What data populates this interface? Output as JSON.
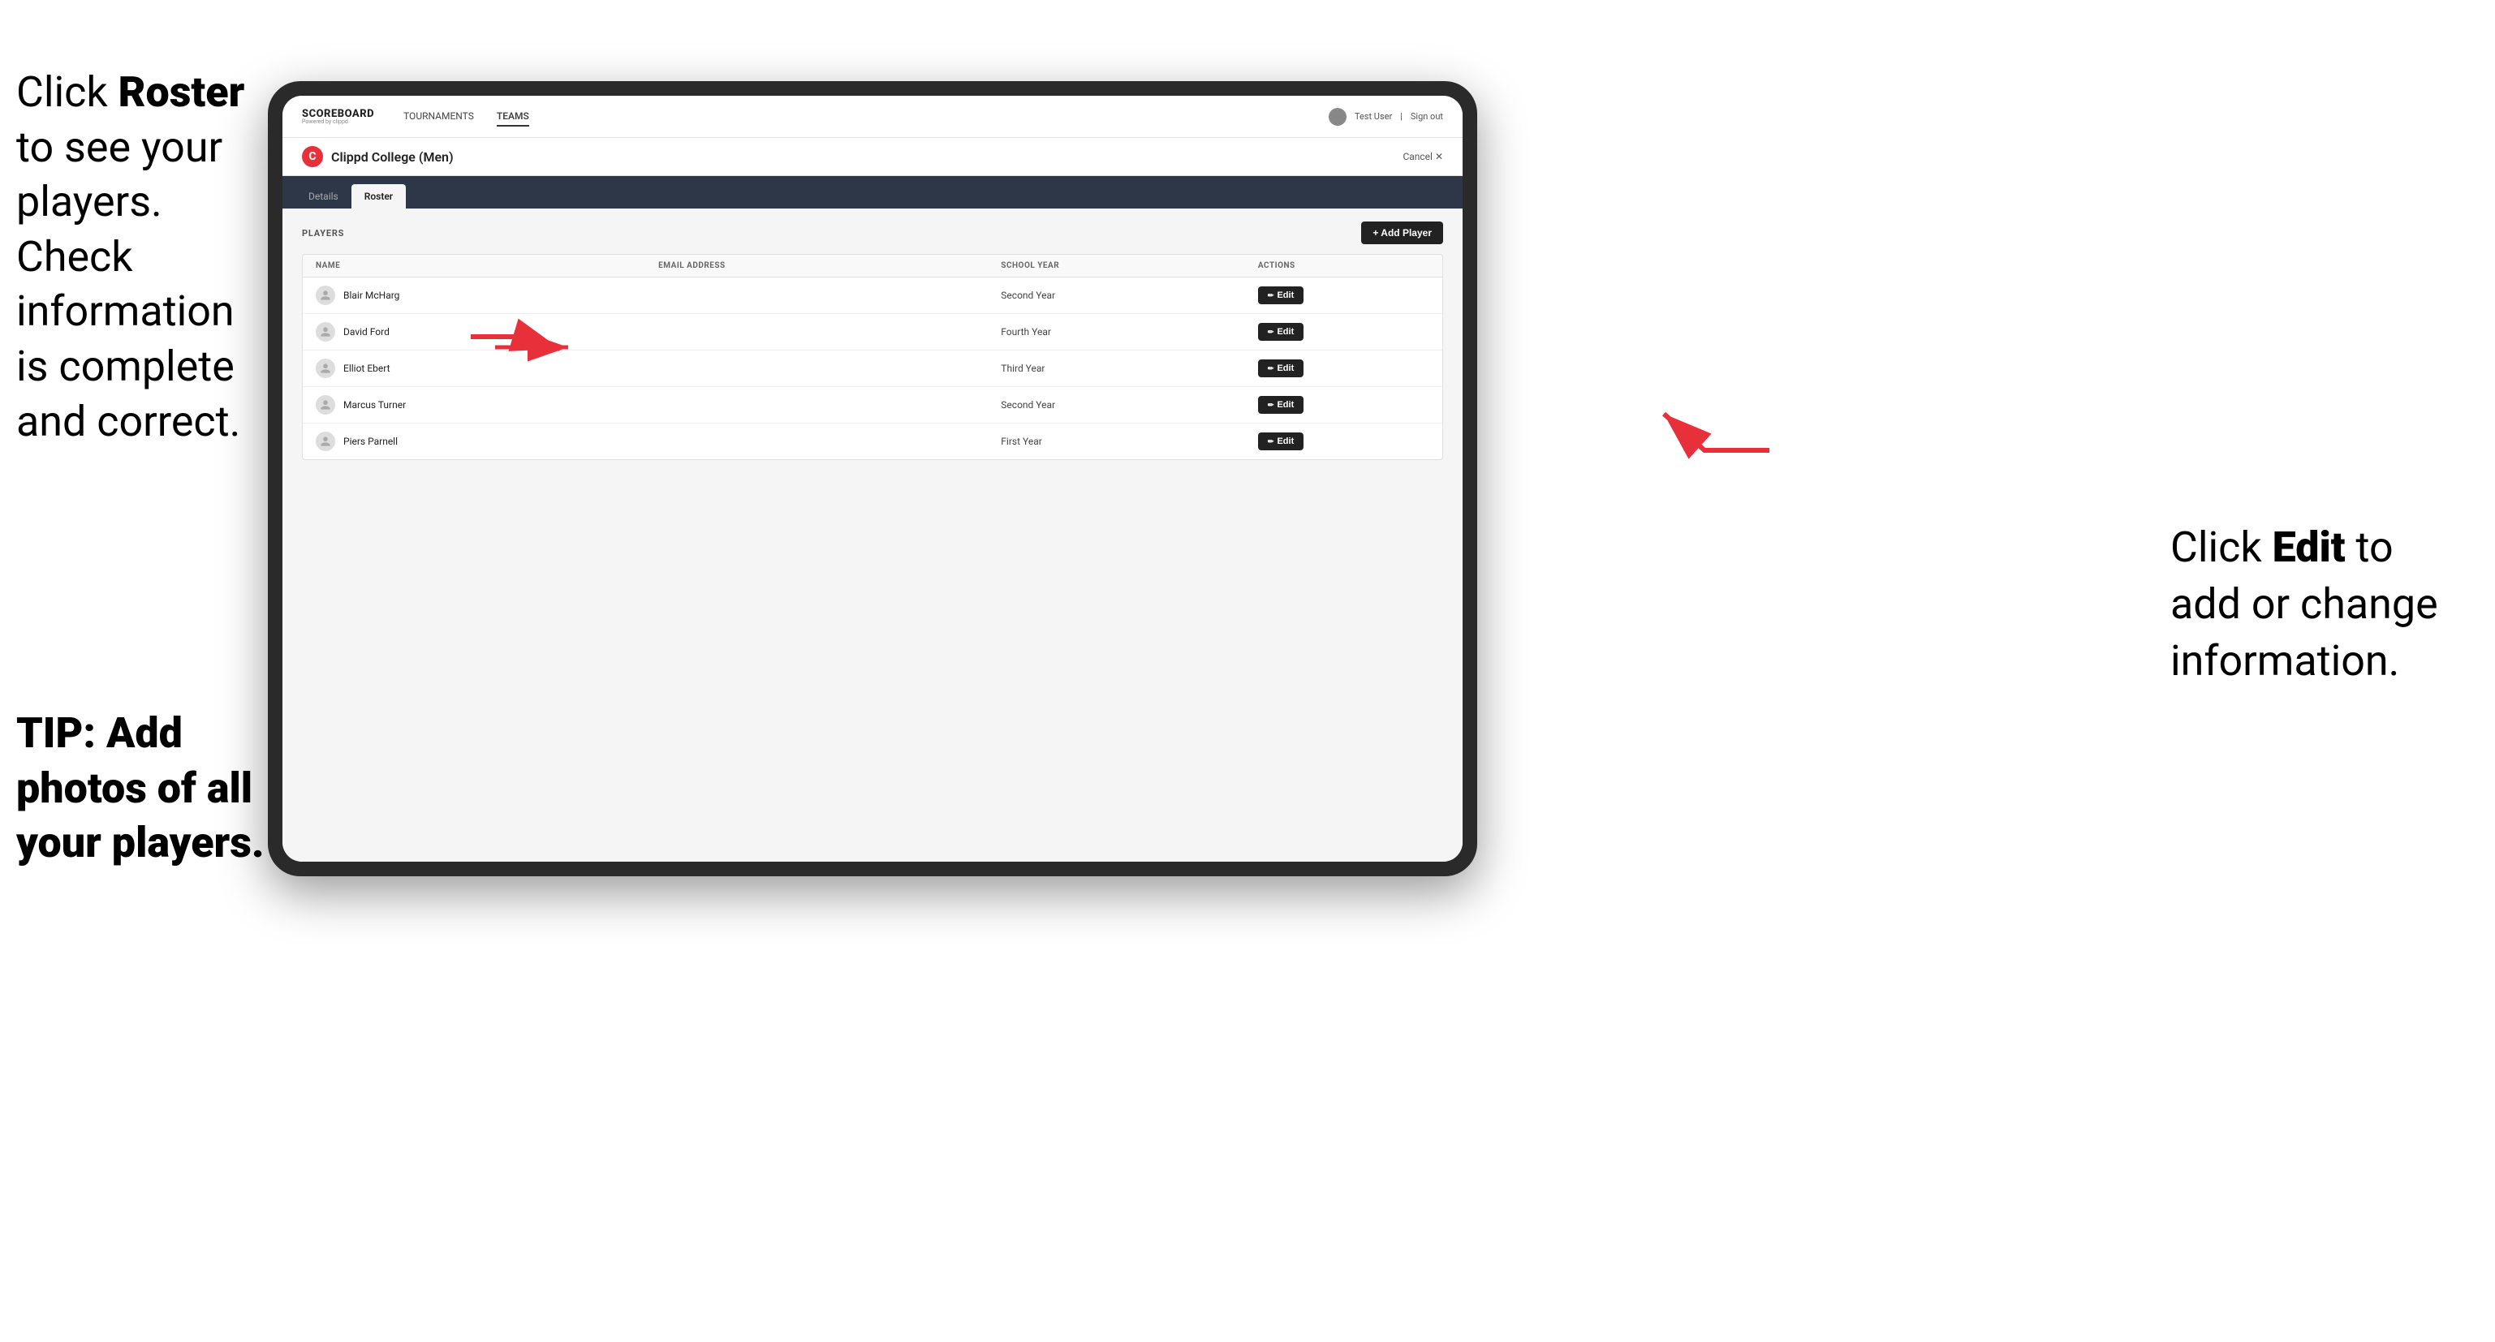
{
  "annotations": {
    "left_title": "Click ",
    "left_bold": "Roster",
    "left_rest": " to see your players. Check information is complete and correct.",
    "tip": "TIP: Add photos of all your players.",
    "right_click": "Click ",
    "right_bold": "Edit",
    "right_rest": " to add or change information."
  },
  "header": {
    "logo": "SCOREBOARD",
    "logo_sub": "Powered by clippd",
    "nav": [
      "TOURNAMENTS",
      "TEAMS"
    ],
    "active_nav": "TEAMS",
    "user": "Test User",
    "sign_out": "Sign out"
  },
  "team": {
    "logo_letter": "C",
    "name": "Clippd College (Men)",
    "cancel": "Cancel ✕"
  },
  "tabs": [
    {
      "label": "Details",
      "active": false
    },
    {
      "label": "Roster",
      "active": true
    }
  ],
  "players_section": {
    "title": "PLAYERS",
    "add_button": "+ Add Player"
  },
  "table": {
    "columns": [
      "NAME",
      "EMAIL ADDRESS",
      "SCHOOL YEAR",
      "ACTIONS"
    ],
    "rows": [
      {
        "name": "Blair McHarg",
        "email": "",
        "school_year": "Second Year"
      },
      {
        "name": "David Ford",
        "email": "",
        "school_year": "Fourth Year"
      },
      {
        "name": "Elliot Ebert",
        "email": "",
        "school_year": "Third Year"
      },
      {
        "name": "Marcus Turner",
        "email": "",
        "school_year": "Second Year"
      },
      {
        "name": "Piers Parnell",
        "email": "",
        "school_year": "First Year"
      }
    ],
    "edit_label": "Edit"
  }
}
